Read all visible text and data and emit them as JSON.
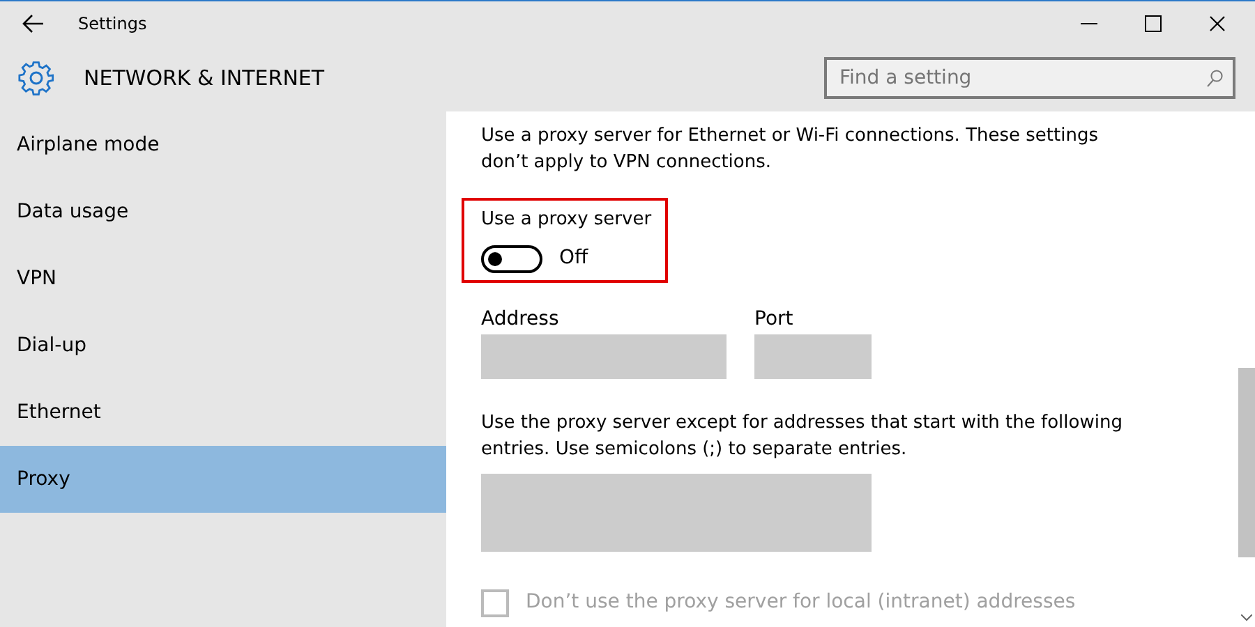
{
  "window": {
    "title": "Settings"
  },
  "header": {
    "title": "NETWORK & INTERNET"
  },
  "search": {
    "placeholder": "Find a setting"
  },
  "sidebar": {
    "items": [
      {
        "label": "Airplane mode",
        "selected": false
      },
      {
        "label": "Data usage",
        "selected": false
      },
      {
        "label": "VPN",
        "selected": false
      },
      {
        "label": "Dial-up",
        "selected": false
      },
      {
        "label": "Ethernet",
        "selected": false
      },
      {
        "label": "Proxy",
        "selected": true
      }
    ]
  },
  "content": {
    "intro": "Use a proxy server for Ethernet or Wi-Fi connections. These settings don’t apply to VPN connections.",
    "proxy_toggle": {
      "label": "Use a proxy server",
      "on": false,
      "state_text": "Off",
      "highlighted": true
    },
    "address": {
      "label": "Address",
      "disabled": true
    },
    "port": {
      "label": "Port",
      "disabled": true
    },
    "exceptions_text": "Use the proxy server except for addresses that start with the following entries. Use semicolons (;) to separate entries.",
    "exceptions": {
      "disabled": true
    },
    "local_checkbox": {
      "label": "Don’t use the proxy server for local (intranet) addresses",
      "checked": false,
      "disabled": true
    }
  }
}
